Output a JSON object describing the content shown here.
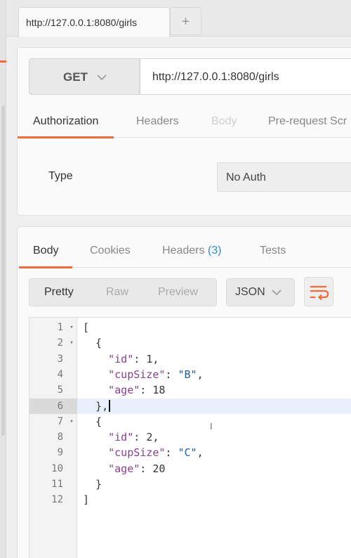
{
  "tab": {
    "title": "http://127.0.0.1:8080/girls",
    "add": "+"
  },
  "request": {
    "method": "GET",
    "url": "http://127.0.0.1:8080/girls",
    "tabs": [
      {
        "label": "Authorization",
        "state": "active"
      },
      {
        "label": "Headers",
        "state": "normal"
      },
      {
        "label": "Body",
        "state": "disabled"
      },
      {
        "label": "Pre-request Scr",
        "state": "normal"
      }
    ],
    "type_label": "Type",
    "auth_value": "No Auth"
  },
  "response": {
    "tabs": [
      {
        "label": "Body",
        "state": "active"
      },
      {
        "label": "Cookies",
        "state": "normal"
      },
      {
        "label": "Headers",
        "count": "(3)",
        "state": "normal"
      },
      {
        "label": "Tests",
        "state": "normal"
      }
    ],
    "views": [
      "Pretty",
      "Raw",
      "Preview"
    ],
    "active_view": "Pretty",
    "format": "JSON",
    "wrap_icon": "wrap-lines-icon"
  },
  "code_lines": [
    {
      "n": "1",
      "fold": true,
      "text": "["
    },
    {
      "n": "2",
      "fold": true,
      "text": "  {"
    },
    {
      "n": "3",
      "key": "\"id\"",
      "value": "1",
      "comma": true
    },
    {
      "n": "4",
      "key": "\"cupSize\"",
      "value": "\"B\"",
      "comma": true,
      "str": true
    },
    {
      "n": "5",
      "key": "\"age\"",
      "value": "18"
    },
    {
      "n": "6",
      "text": "  },",
      "highlight": true
    },
    {
      "n": "7",
      "fold": true,
      "text": "  {"
    },
    {
      "n": "8",
      "key": "\"id\"",
      "value": "2",
      "comma": true
    },
    {
      "n": "9",
      "key": "\"cupSize\"",
      "value": "\"C\"",
      "comma": true,
      "str": true
    },
    {
      "n": "10",
      "key": "\"age\"",
      "value": "20"
    },
    {
      "n": "11",
      "text": "  }"
    },
    {
      "n": "12",
      "text": "]"
    }
  ],
  "colors": {
    "accent": "#f26b3a",
    "count": "#2e8dd0",
    "key": "#8a3f8f",
    "string": "#1f5d9a"
  }
}
